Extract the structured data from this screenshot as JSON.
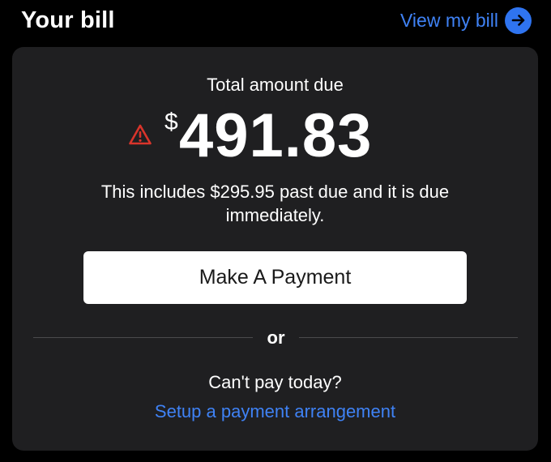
{
  "header": {
    "title": "Your bill",
    "view_bill_label": "View my bill",
    "view_bill_icon": "arrow-right-circle-icon"
  },
  "bill": {
    "amount_label": "Total amount due",
    "currency_symbol": "$",
    "amount": "491.83",
    "warning_icon": "warning-triangle-icon",
    "past_due_note": "This includes $295.95 past due and it is due immediately."
  },
  "actions": {
    "pay_button_label": "Make A Payment",
    "or_label": "or",
    "cant_pay_label": "Can't pay today?",
    "arrangement_link_label": "Setup a payment arrangement"
  },
  "colors": {
    "background": "#000000",
    "card": "#1f1f21",
    "accent_blue": "#3f82f5",
    "warning_red": "#d9342b",
    "button_bg": "#ffffff"
  }
}
